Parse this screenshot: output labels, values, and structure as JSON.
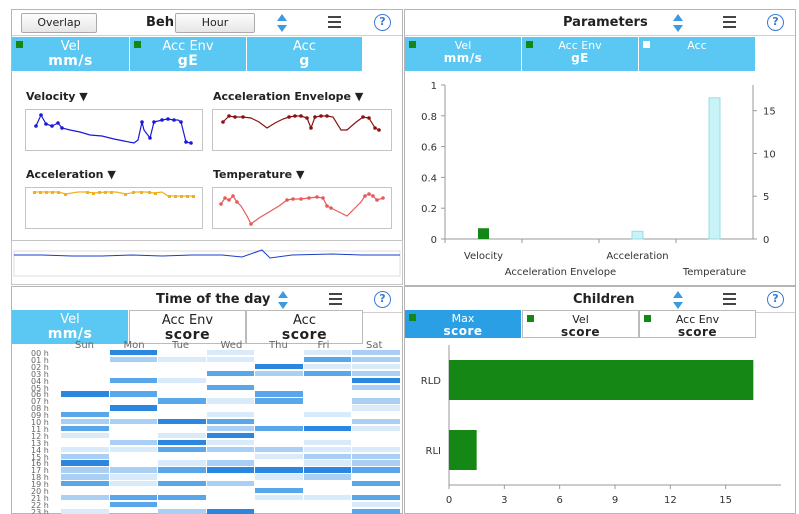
{
  "behavior": {
    "overlap_label": "Overlap",
    "title": "Beh",
    "hour_label": "Hour",
    "help": "?",
    "tabs": [
      {
        "l1": "Vel",
        "l2": "mm/s"
      },
      {
        "l1": "Acc Env",
        "l2": "gE"
      },
      {
        "l1": "Acc",
        "l2": "g"
      }
    ],
    "mini_charts": [
      {
        "label": "Velocity",
        "color": "#1a1ad8"
      },
      {
        "label": "Acceleration Envelope",
        "color": "#8b1010"
      },
      {
        "label": "Acceleration",
        "color": "#f0b020"
      },
      {
        "label": "Temperature",
        "color": "#e85a5a"
      }
    ]
  },
  "parameters": {
    "title": "Parameters",
    "help": "?",
    "tabs": [
      {
        "l1": "Vel",
        "l2": "mm/s"
      },
      {
        "l1": "Acc Env",
        "l2": "gE"
      },
      {
        "l1": "Acc",
        "l2": ""
      }
    ],
    "left_ticks": [
      "1",
      "0.8",
      "0.6",
      "0.4",
      "0.2",
      "0"
    ],
    "right_ticks": [
      "15",
      "10",
      "5",
      "0"
    ],
    "categories": [
      "Velocity",
      "Acceleration Envelope",
      "Acceleration",
      "Temperature"
    ]
  },
  "time_of_day": {
    "title": "Time of the day",
    "help": "?",
    "tabs": [
      {
        "l1": "Vel",
        "l2": "mm/s"
      },
      {
        "l1": "Acc Env",
        "l2": "score"
      },
      {
        "l1": "Acc",
        "l2": "score"
      }
    ],
    "days": [
      "Sun",
      "Mon",
      "Tue",
      "Wed",
      "Thu",
      "Fri",
      "Sat"
    ],
    "hours": [
      "00 h",
      "01 h",
      "02 h",
      "03 h",
      "04 h",
      "05 h",
      "06 h",
      "07 h",
      "08 h",
      "09 h",
      "10 h",
      "11 h",
      "12 h",
      "13 h",
      "14 h",
      "15 h",
      "16 h",
      "17 h",
      "18 h",
      "19 h",
      "20 h",
      "21 h",
      "22 h",
      "23 h"
    ]
  },
  "children": {
    "title": "Children",
    "help": "?",
    "tabs": [
      {
        "l1": "Max",
        "l2": "score"
      },
      {
        "l1": "Vel",
        "l2": "score"
      },
      {
        "l1": "Acc Env",
        "l2": "score"
      }
    ],
    "x_ticks": [
      "0",
      "3",
      "6",
      "9",
      "12",
      "15"
    ]
  },
  "chart_data": [
    {
      "type": "bar",
      "title": "Parameters",
      "categories": [
        "Velocity",
        "Acceleration Envelope",
        "Acceleration",
        "Temperature"
      ],
      "series": [
        {
          "values": [
            0.07,
            0,
            0,
            0
          ],
          "axis": "left",
          "color": "#148714"
        },
        {
          "values": [
            0,
            0,
            0.9,
            16.5
          ],
          "axis": "right",
          "color": "#c8f4f8"
        }
      ],
      "ylim_left": [
        0,
        1
      ],
      "ylim_right": [
        0,
        18
      ]
    },
    {
      "type": "bar",
      "orientation": "horizontal",
      "title": "Children",
      "categories": [
        "RLD",
        "RLI"
      ],
      "values": [
        16.5,
        1.5
      ],
      "xlim": [
        0,
        18
      ],
      "color": "#148714"
    }
  ]
}
